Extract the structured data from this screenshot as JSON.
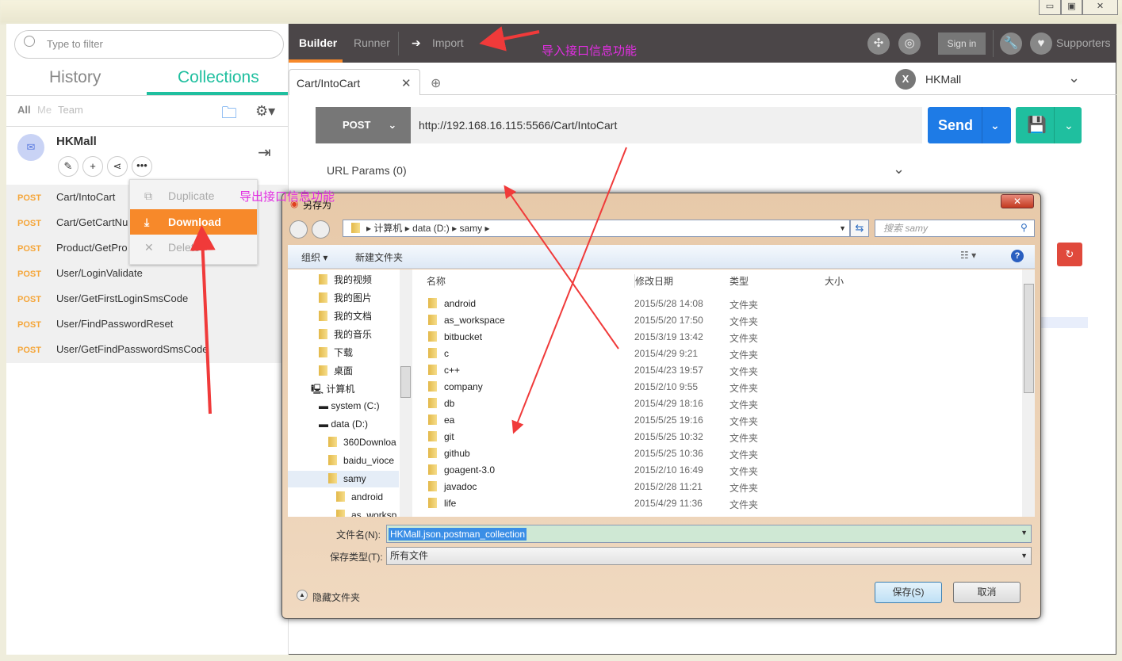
{
  "window": {
    "controls": [
      "▭",
      "▣",
      "✕"
    ]
  },
  "sidebar": {
    "filter_placeholder": "Type to filter",
    "tabs": [
      "History",
      "Collections"
    ],
    "scopes": [
      "All",
      "Me",
      "Team"
    ],
    "collection": {
      "name": "HKMall"
    },
    "requests": [
      {
        "method": "POST",
        "name": "Cart/IntoCart"
      },
      {
        "method": "POST",
        "name": "Cart/GetCartNu"
      },
      {
        "method": "POST",
        "name": "Product/GetPro"
      },
      {
        "method": "POST",
        "name": "User/LoginValidate"
      },
      {
        "method": "POST",
        "name": "User/GetFirstLoginSmsCode"
      },
      {
        "method": "POST",
        "name": "User/FindPasswordReset"
      },
      {
        "method": "POST",
        "name": "User/GetFindPasswordSmsCode"
      }
    ],
    "menu": [
      "Duplicate",
      "Download",
      "Delete"
    ]
  },
  "topbar": {
    "builder": "Builder",
    "runner": "Runner",
    "import": "Import",
    "signin": "Sign in",
    "supporters": "Supporters"
  },
  "tabs": {
    "active": "Cart/IntoCart",
    "environment": "HKMall",
    "env_badge": "X"
  },
  "request": {
    "method": "POST",
    "url": "http://192.168.16.115:5566/Cart/IntoCart",
    "send": "Send",
    "url_params": "URL Params (0)"
  },
  "annotations": {
    "import_note": "导入接口信息功能",
    "export_note": "导出接口信息功能"
  },
  "dialog": {
    "title": "另存为",
    "path": [
      "计算机",
      "data (D:)",
      "samy"
    ],
    "search_placeholder": "搜索 samy",
    "organize": "组织 ▾",
    "new_folder": "新建文件夹",
    "columns": [
      "名称",
      "修改日期",
      "类型",
      "大小"
    ],
    "nav": [
      "我的视频",
      "我的图片",
      "我的文档",
      "我的音乐",
      "下载",
      "桌面",
      "计算机",
      "system (C:)",
      "data (D:)",
      "360Downloa",
      "baidu_vioce",
      "samy",
      "android",
      "as_worksp"
    ],
    "files": [
      [
        "android",
        "2015/5/28 14:08",
        "文件夹"
      ],
      [
        "as_workspace",
        "2015/5/20 17:50",
        "文件夹"
      ],
      [
        "bitbucket",
        "2015/3/19 13:42",
        "文件夹"
      ],
      [
        "c",
        "2015/4/29 9:21",
        "文件夹"
      ],
      [
        "c++",
        "2015/4/23 19:57",
        "文件夹"
      ],
      [
        "company",
        "2015/2/10 9:55",
        "文件夹"
      ],
      [
        "db",
        "2015/4/29 18:16",
        "文件夹"
      ],
      [
        "ea",
        "2015/5/25 19:16",
        "文件夹"
      ],
      [
        "git",
        "2015/5/25 10:32",
        "文件夹"
      ],
      [
        "github",
        "2015/5/25 10:36",
        "文件夹"
      ],
      [
        "goagent-3.0",
        "2015/2/10 16:49",
        "文件夹"
      ],
      [
        "javadoc",
        "2015/2/28 11:21",
        "文件夹"
      ],
      [
        "life",
        "2015/4/29 11:36",
        "文件夹"
      ]
    ],
    "filename_label": "文件名(N):",
    "filename": "HKMall.json.postman_collection",
    "type_label": "保存类型(T):",
    "type_value": "所有文件",
    "hide_folders": "隐藏文件夹",
    "save": "保存(S)",
    "cancel": "取消"
  },
  "colors": {
    "accent_teal": "#1fbf9f",
    "send_blue": "#1e7be6",
    "orange": "#f7892a",
    "annotation": "#e22ee2",
    "arrow": "#f03a3a"
  }
}
